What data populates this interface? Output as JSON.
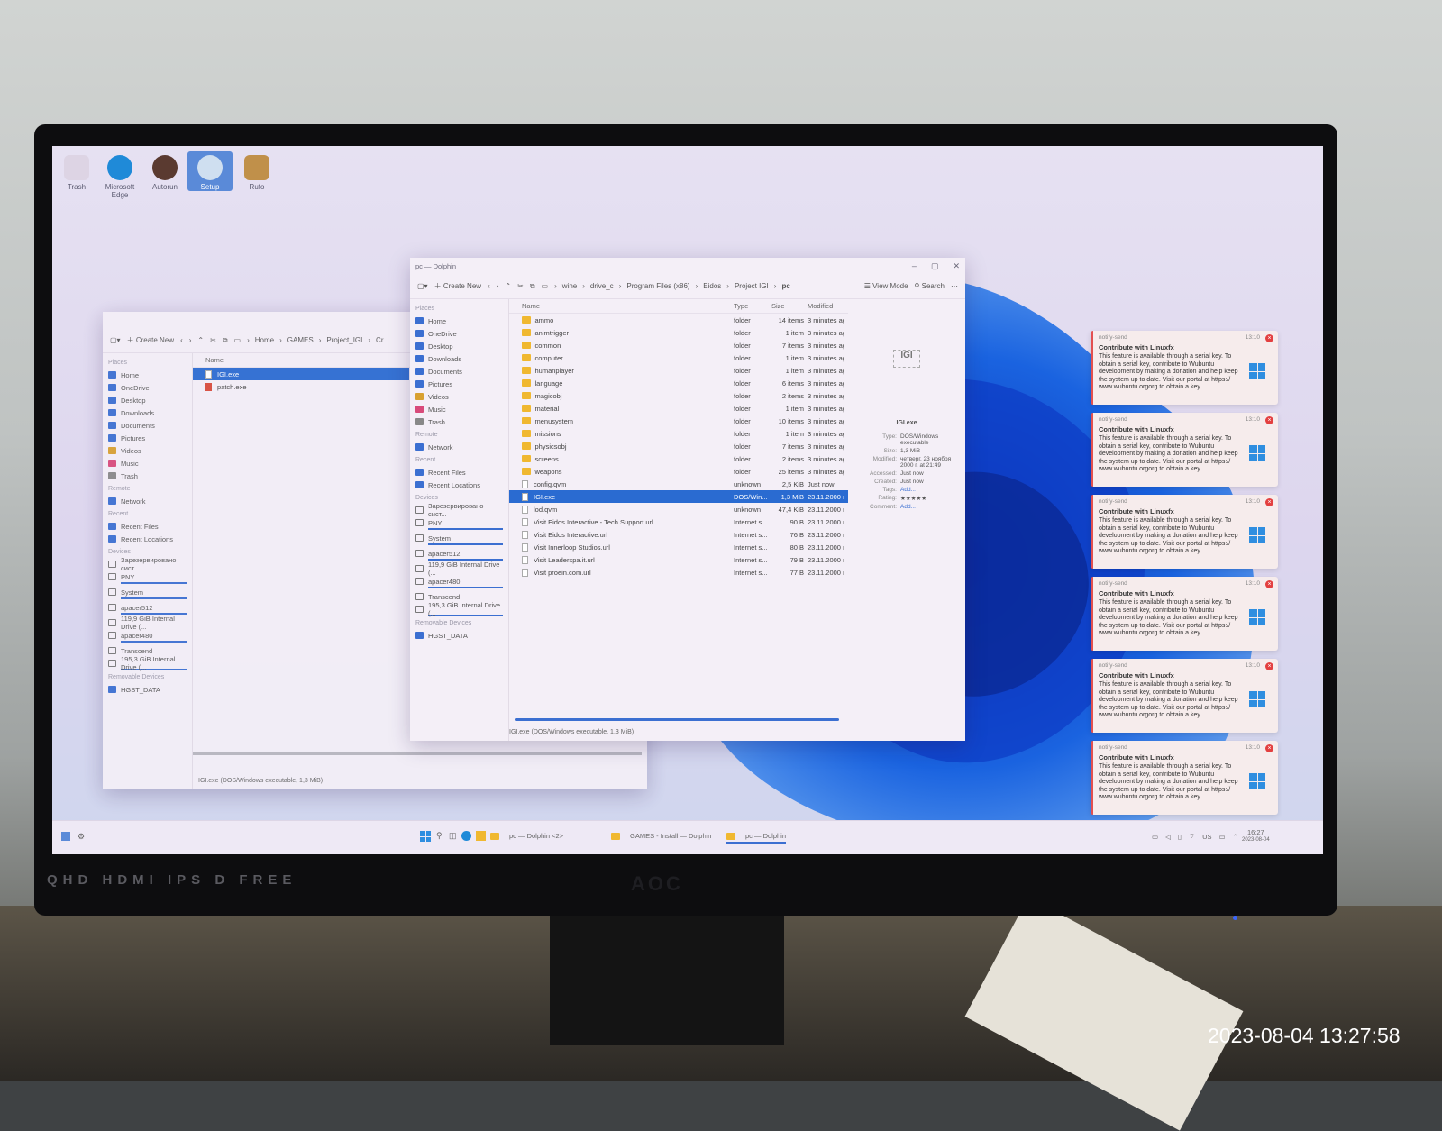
{
  "photo_timestamp": "2023-08-04 13:27:58",
  "bezel": {
    "labels": "QHD HDMI IPS D FREE",
    "brand": "AOC"
  },
  "desktop_icons": [
    {
      "label": "Trash",
      "color": "#d8d0e0"
    },
    {
      "label": "Microsoft Edge",
      "color": "#1f8ad8"
    },
    {
      "label": "Autorun",
      "color": "#5a3a30"
    },
    {
      "label": "Setup",
      "color": "#4a8ad0"
    },
    {
      "label": "Rufo",
      "color": "#c0904a"
    }
  ],
  "back_window": {
    "toolbar": {
      "create_new": "Create New"
    },
    "breadcrumb": [
      "Home",
      "GAMES",
      "Project_IGI",
      "Cr"
    ],
    "places": {
      "section_places": "Places",
      "places": [
        "Home",
        "OneDrive",
        "Desktop",
        "Downloads",
        "Documents",
        "Pictures",
        "Videos",
        "Music",
        "Trash"
      ],
      "section_remote": "Remote",
      "remote": [
        "Network"
      ],
      "section_recent": "Recent",
      "recent": [
        "Recent Files",
        "Recent Locations"
      ],
      "section_devices": "Devices",
      "devices": [
        "Зарезервировано сист...",
        "PNY",
        "System",
        "apacer512",
        "119,9 GiB Internal Drive (...",
        "apacer480",
        "Transcend",
        "195,3 GiB Internal Drive (..."
      ],
      "section_removable": "Removable Devices",
      "removable": [
        "HGST_DATA"
      ]
    },
    "column_name": "Name",
    "files": [
      "IGI.exe",
      "patch.exe"
    ],
    "status": "IGI.exe (DOS/Windows executable, 1,3 MiB)"
  },
  "front_window": {
    "title": "pc — Dolphin",
    "toolbar": {
      "create_new": "Create New",
      "view_mode": "View Mode",
      "search": "Search"
    },
    "breadcrumb": [
      "wine",
      "drive_c",
      "Program Files (x86)",
      "Eidos",
      "Project IGI",
      "pc"
    ],
    "places": {
      "section_places": "Places",
      "places": [
        "Home",
        "OneDrive",
        "Desktop",
        "Downloads",
        "Documents",
        "Pictures",
        "Videos",
        "Music",
        "Trash"
      ],
      "section_remote": "Remote",
      "remote": [
        "Network"
      ],
      "section_recent": "Recent",
      "recent": [
        "Recent Files",
        "Recent Locations"
      ],
      "section_devices": "Devices",
      "devices": [
        "Зарезервировано сист...",
        "PNY",
        "System",
        "apacer512",
        "119,9 GiB Internal Drive (...",
        "apacer480",
        "Transcend",
        "195,3 GiB Internal Drive (..."
      ],
      "section_removable": "Removable Devices",
      "removable": [
        "HGST_DATA"
      ]
    },
    "columns": {
      "name": "Name",
      "type": "Type",
      "size": "Size",
      "modified": "Modified"
    },
    "rows": [
      {
        "name": "ammo",
        "type": "folder",
        "size": "14 items",
        "modified": "3 minutes ag",
        "kind": "folder"
      },
      {
        "name": "animtrigger",
        "type": "folder",
        "size": "1 item",
        "modified": "3 minutes ag",
        "kind": "folder"
      },
      {
        "name": "common",
        "type": "folder",
        "size": "7 items",
        "modified": "3 minutes ag",
        "kind": "folder"
      },
      {
        "name": "computer",
        "type": "folder",
        "size": "1 item",
        "modified": "3 minutes ag",
        "kind": "folder"
      },
      {
        "name": "humanplayer",
        "type": "folder",
        "size": "1 item",
        "modified": "3 minutes ag",
        "kind": "folder"
      },
      {
        "name": "language",
        "type": "folder",
        "size": "6 items",
        "modified": "3 minutes ag",
        "kind": "folder"
      },
      {
        "name": "magicobj",
        "type": "folder",
        "size": "2 items",
        "modified": "3 minutes ag",
        "kind": "folder"
      },
      {
        "name": "material",
        "type": "folder",
        "size": "1 item",
        "modified": "3 minutes ag",
        "kind": "folder"
      },
      {
        "name": "menusystem",
        "type": "folder",
        "size": "10 items",
        "modified": "3 minutes ag",
        "kind": "folder"
      },
      {
        "name": "missions",
        "type": "folder",
        "size": "1 item",
        "modified": "3 minutes ag",
        "kind": "folder"
      },
      {
        "name": "physicsobj",
        "type": "folder",
        "size": "7 items",
        "modified": "3 minutes ag",
        "kind": "folder"
      },
      {
        "name": "screens",
        "type": "folder",
        "size": "2 items",
        "modified": "3 minutes ag",
        "kind": "folder"
      },
      {
        "name": "weapons",
        "type": "folder",
        "size": "25 items",
        "modified": "3 minutes ag",
        "kind": "folder"
      },
      {
        "name": "config.qvm",
        "type": "unknown",
        "size": "2,5 KiB",
        "modified": "Just now",
        "kind": "file"
      },
      {
        "name": "IGI.exe",
        "type": "DOS/Win...",
        "size": "1,3 MiB",
        "modified": "23.11.2000 г.",
        "kind": "exe",
        "selected": true
      },
      {
        "name": "lod.qvm",
        "type": "unknown",
        "size": "47,4 KiB",
        "modified": "23.11.2000 г.",
        "kind": "file"
      },
      {
        "name": "Visit Eidos Interactive - Tech Support.url",
        "type": "Internet s...",
        "size": "90 B",
        "modified": "23.11.2000 г.",
        "kind": "file"
      },
      {
        "name": "Visit Eidos Interactive.url",
        "type": "Internet s...",
        "size": "76 B",
        "modified": "23.11.2000 г.",
        "kind": "file"
      },
      {
        "name": "Visit Innerloop Studios.url",
        "type": "Internet s...",
        "size": "80 B",
        "modified": "23.11.2000 г.",
        "kind": "file"
      },
      {
        "name": "Visit Leaderspa.it.url",
        "type": "Internet s...",
        "size": "79 B",
        "modified": "23.11.2000 г.",
        "kind": "file"
      },
      {
        "name": "Visit proein.com.url",
        "type": "Internet s...",
        "size": "77 B",
        "modified": "23.11.2000 г.",
        "kind": "file"
      }
    ],
    "status": "IGI.exe (DOS/Windows executable, 1,3 MiB)",
    "info": {
      "preview_text": "IGI",
      "filename": "IGI.exe",
      "type_label": "Type:",
      "type_value": "DOS/Windows executable",
      "size_label": "Size:",
      "size_value": "1,3 MiB",
      "modified_label": "Modified:",
      "modified_value": "четверг, 23 ноября 2000 г. at 21:49",
      "accessed_label": "Accessed:",
      "accessed_value": "Just now",
      "created_label": "Created:",
      "created_value": "Just now",
      "tags_label": "Tags:",
      "tags_value": "Add...",
      "rating_label": "Rating:",
      "rating_value": "★★★★★",
      "comment_label": "Comment:",
      "comment_value": "Add..."
    }
  },
  "notifications": [
    {
      "app": "notify-send",
      "time": "13:10",
      "title": "Contribute with Linuxfx",
      "body": "This feature is available through a serial key. To obtain a serial key, contribute to Wubuntu development by making a donation and help keep the system up to date. Visit our portal at https:// www.wubuntu.orgorg to obtain a key."
    },
    {
      "app": "notify-send",
      "time": "13:10",
      "title": "Contribute with Linuxfx",
      "body": "This feature is available through a serial key. To obtain a serial key, contribute to Wubuntu development by making a donation and help keep the system up to date. Visit our portal at https:// www.wubuntu.orgorg to obtain a key."
    },
    {
      "app": "notify-send",
      "time": "13:10",
      "title": "Contribute with Linuxfx",
      "body": "This feature is available through a serial key. To obtain a serial key, contribute to Wubuntu development by making a donation and help keep the system up to date. Visit our portal at https:// www.wubuntu.orgorg to obtain a key."
    },
    {
      "app": "notify-send",
      "time": "13:10",
      "title": "Contribute with Linuxfx",
      "body": "This feature is available through a serial key. To obtain a serial key, contribute to Wubuntu development by making a donation and help keep the system up to date. Visit our portal at https:// www.wubuntu.orgorg to obtain a key."
    },
    {
      "app": "notify-send",
      "time": "13:10",
      "title": "Contribute with Linuxfx",
      "body": "This feature is available through a serial key. To obtain a serial key, contribute to Wubuntu development by making a donation and help keep the system up to date. Visit our portal at https:// www.wubuntu.orgorg to obtain a key."
    },
    {
      "app": "notify-send",
      "time": "13:10",
      "title": "Contribute with Linuxfx",
      "body": "This feature is available through a serial key. To obtain a serial key, contribute to Wubuntu development by making a donation and help keep the system up to date. Visit our portal at https:// www.wubuntu.orgorg to obtain a key."
    }
  ],
  "taskbar": {
    "tasks": [
      "pc — Dolphin <2>",
      "GAMES - Install — Dolphin",
      "pc — Dolphin"
    ],
    "tray": {
      "keyboard": "US",
      "time": "16:27",
      "date": "2023-08-04"
    }
  }
}
